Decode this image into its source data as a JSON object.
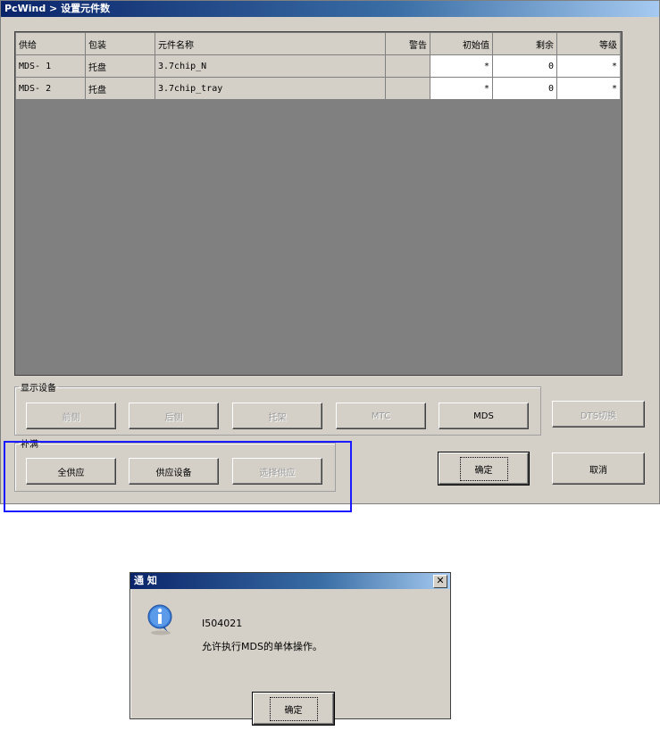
{
  "window": {
    "title": "PcWind > 设置元件数"
  },
  "table": {
    "headers": [
      "供给",
      "包装",
      "元件名称",
      "警告",
      "初始值",
      "剩余",
      "等级"
    ],
    "rows": [
      [
        "MDS- 1",
        "托盘",
        "3.7chip_N",
        "",
        "*",
        "0",
        "*"
      ],
      [
        "MDS- 2",
        "托盘",
        "3.7chip_tray",
        "",
        "*",
        "0",
        "*"
      ]
    ]
  },
  "display_group": {
    "label": "显示设备",
    "buttons": [
      "前侧",
      "后侧",
      "托架",
      "MTC",
      "MDS"
    ]
  },
  "dts_button": "DTS切换",
  "supply_group": {
    "label": "补满",
    "buttons": [
      "全供应",
      "供应设备",
      "选择供应"
    ]
  },
  "ok_button": "确定",
  "cancel_button": "取消",
  "dialog": {
    "title": "通 知",
    "close": "✕",
    "code": "I504021",
    "message": "允许执行MDS的单体操作。",
    "ok_button": "确定"
  }
}
